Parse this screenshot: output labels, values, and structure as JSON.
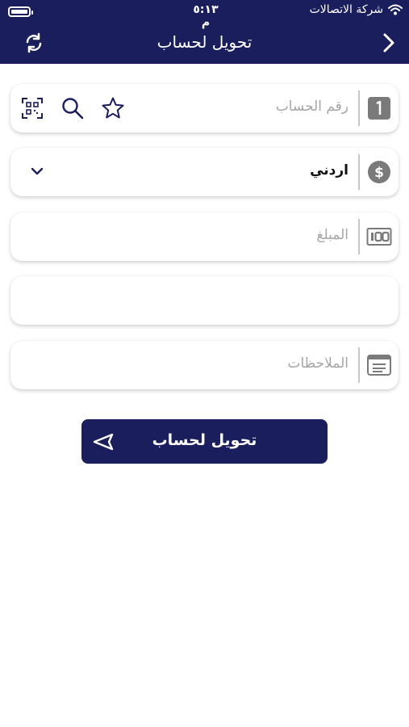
{
  "status_bar": {
    "carrier": "شركة الاتصالات",
    "time": "٥:١٣ م"
  },
  "nav": {
    "title": "تحويل لحساب"
  },
  "form": {
    "account": {
      "placeholder": "رقم الحساب",
      "lead_icon": "number-one-icon"
    },
    "currency": {
      "value": "اردني",
      "lead_icon": "dollar-icon"
    },
    "amount": {
      "placeholder": "المبلغ",
      "lead_icon": "banknote-100-icon"
    },
    "extra": {
      "value": ""
    },
    "notes": {
      "placeholder": "الملاحظات",
      "lead_icon": "notes-icon"
    }
  },
  "submit": {
    "label": "تحويل لحساب",
    "icon": "send-icon"
  },
  "colors": {
    "primary": "#1a1e5c",
    "icon_gray": "#7a7a7a"
  }
}
